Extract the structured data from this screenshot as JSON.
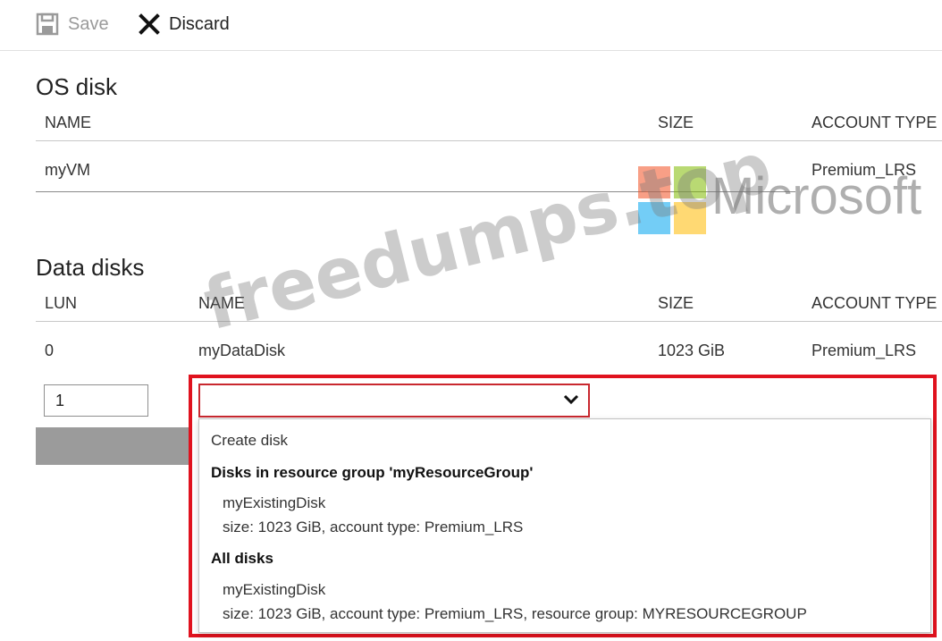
{
  "toolbar": {
    "save_label": "Save",
    "discard_label": "Discard"
  },
  "os_disk": {
    "title": "OS disk",
    "headers": {
      "name": "NAME",
      "size": "SIZE",
      "account_type": "ACCOUNT TYPE"
    },
    "row": {
      "name": "myVM",
      "size": "",
      "account_type": "Premium_LRS"
    }
  },
  "data_disks": {
    "title": "Data disks",
    "headers": {
      "lun": "LUN",
      "name": "NAME",
      "size": "SIZE",
      "account_type": "ACCOUNT TYPE"
    },
    "rows": [
      {
        "lun": "0",
        "name": "myDataDisk",
        "size": "1023 GiB",
        "account_type": "Premium_LRS"
      }
    ],
    "new_row": {
      "lun_value": "1",
      "name_value": ""
    }
  },
  "dropdown": {
    "create_label": "Create disk",
    "group_rg": "Disks in resource group 'myResourceGroup'",
    "rg_disk_name": "myExistingDisk",
    "rg_disk_detail": "size: 1023 GiB, account type: Premium_LRS",
    "group_all": "All disks",
    "all_disk_name": "myExistingDisk",
    "all_disk_detail": "size: 1023 GiB, account type: Premium_LRS, resource group: MYRESOURCEGROUP"
  },
  "watermark": {
    "site": "freedumps.top",
    "brand": "Microsoft"
  },
  "colors": {
    "highlight": "#e0121e",
    "ms_red": "#f25022",
    "ms_green": "#7fba00",
    "ms_blue": "#00a4ef",
    "ms_yellow": "#ffb900"
  },
  "icons": {
    "save": "save-icon",
    "discard": "close-icon",
    "select_chevron": "chevron-down-icon"
  }
}
